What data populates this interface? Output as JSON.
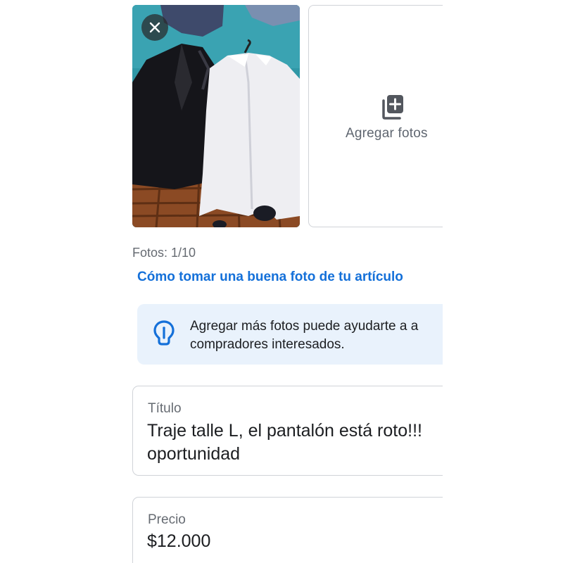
{
  "photos": {
    "remove_icon": "close-icon",
    "add_label": "Agregar fotos",
    "add_icon": "add-photo-icon",
    "count": "Fotos: 1/10",
    "tip_link": "Cómo tomar una buena foto de tu artículo"
  },
  "tip": {
    "icon": "lightbulb-icon",
    "line1": "Agregar más fotos puede ayudarte a a",
    "line2": "compradores interesados."
  },
  "title_field": {
    "label": "Título",
    "value_line1": "Traje talle L, el pantalón está roto!!!",
    "value_line2": "oportunidad"
  },
  "price_field": {
    "label": "Precio",
    "value": "$12.000"
  },
  "colors": {
    "link": "#1470d9",
    "tip_background": "#e9f2fc",
    "border": "#d0d3d8"
  }
}
